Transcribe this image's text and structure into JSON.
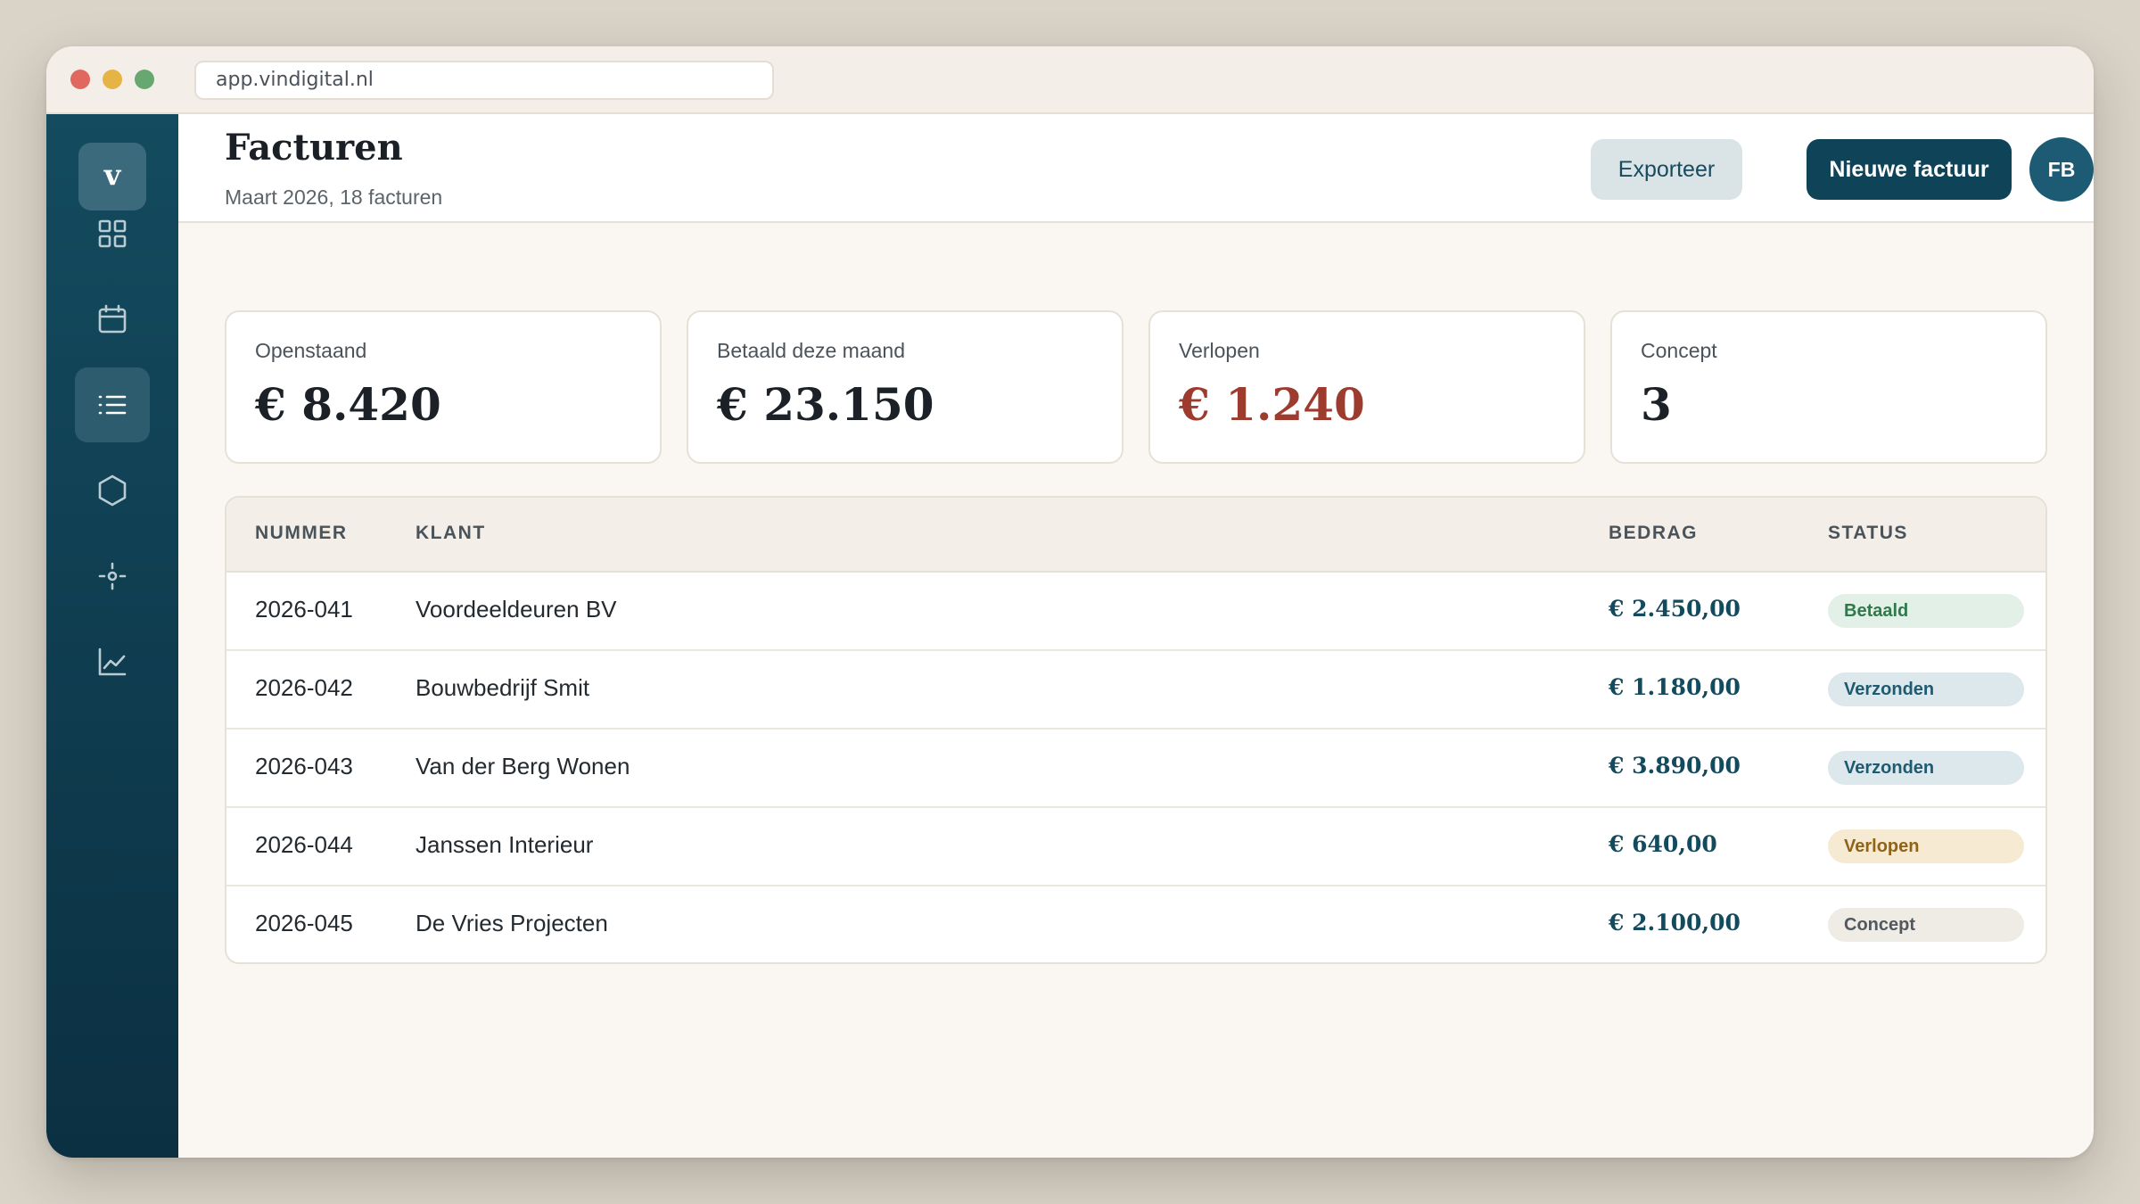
{
  "browser": {
    "url": "app.vindigital.nl"
  },
  "sidebar": {
    "logo": "v",
    "items": [
      {
        "icon": "grid-icon",
        "active": false
      },
      {
        "icon": "calendar-icon",
        "active": false
      },
      {
        "icon": "list-icon",
        "active": true
      },
      {
        "icon": "hexagon-icon",
        "active": false
      },
      {
        "icon": "target-icon",
        "active": false
      },
      {
        "icon": "chart-line-icon",
        "active": false
      }
    ]
  },
  "header": {
    "title": "Facturen",
    "subtitle": "Maart 2026, 18 facturen",
    "export_label": "Exporteer",
    "new_label": "Nieuwe factuur",
    "avatar_initials": "FB"
  },
  "cards": [
    {
      "label": "Openstaand",
      "value": "€ 8.420"
    },
    {
      "label": "Betaald deze maand",
      "value": "€ 23.150"
    },
    {
      "label": "Verlopen",
      "value": "€ 1.240",
      "color": "#9c3b2e"
    },
    {
      "label": "Concept",
      "value": "3"
    }
  ],
  "table": {
    "columns": {
      "nummer": "NUMMER",
      "klant": "KLANT",
      "bedrag": "BEDRAG",
      "status": "STATUS"
    },
    "rows": [
      {
        "nummer": "2026-041",
        "klant": "Voordeeldeuren BV",
        "bedrag": "€ 2.450,00",
        "status": "Betaald",
        "status_bg": "#e3f0e7",
        "status_fg": "#2e7a4b"
      },
      {
        "nummer": "2026-042",
        "klant": "Bouwbedrijf Smit",
        "bedrag": "€ 1.180,00",
        "status": "Verzonden",
        "status_bg": "#dde8ec",
        "status_fg": "#1d5b73"
      },
      {
        "nummer": "2026-043",
        "klant": "Van der Berg Wonen",
        "bedrag": "€ 3.890,00",
        "status": "Verzonden",
        "status_bg": "#dde8ec",
        "status_fg": "#1d5b73"
      },
      {
        "nummer": "2026-044",
        "klant": "Janssen Interieur",
        "bedrag": "€ 640,00",
        "status": "Verlopen",
        "status_bg": "#f6ead2",
        "status_fg": "#8f6418"
      },
      {
        "nummer": "2026-045",
        "klant": "De Vries Projecten",
        "bedrag": "€ 2.100,00",
        "status": "Concept",
        "status_bg": "#efece6",
        "status_fg": "#51585e"
      }
    ]
  }
}
